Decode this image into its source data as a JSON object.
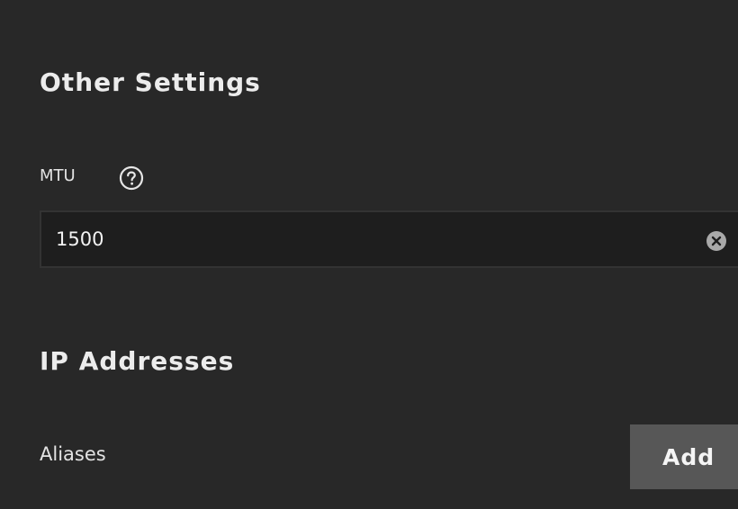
{
  "other_settings": {
    "title": "Other Settings",
    "mtu": {
      "label": "MTU",
      "value": "1500",
      "help_icon": "help-circle-icon",
      "clear_icon": "clear-circle-icon"
    }
  },
  "ip_addresses": {
    "title": "IP Addresses",
    "aliases_label": "Aliases",
    "add_button_label": "Add"
  }
}
